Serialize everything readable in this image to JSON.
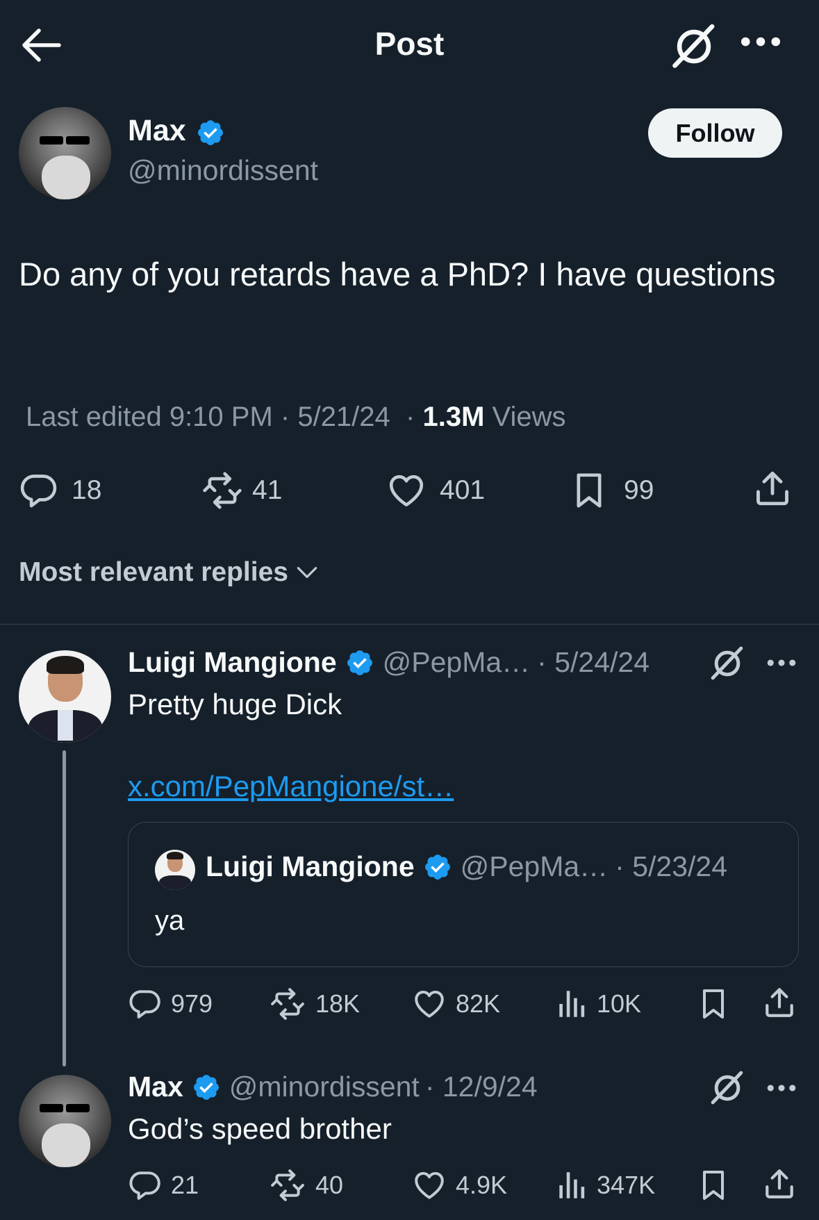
{
  "header": {
    "title": "Post"
  },
  "post": {
    "author_name": "Max",
    "author_handle": "@minordissent",
    "follow_label": "Follow",
    "text": "Do any of you retards have a PhD? I have questions",
    "edited_label": "Last edited 9:10 PM · 5/21/24",
    "views_separator": "·",
    "views_count": "1.3M",
    "views_label": "Views",
    "stats": {
      "replies": "18",
      "reposts": "41",
      "likes": "401",
      "bookmarks": "99"
    }
  },
  "replies_sort": {
    "label": "Most relevant replies"
  },
  "reply1": {
    "name": "Luigi Mangione",
    "handle": "@PepMa…",
    "date": "· 5/24/24",
    "text": "Pretty huge Dick",
    "link": "x.com/PepMangione/st…",
    "quote": {
      "name": "Luigi Mangione",
      "handle": "@PepMa…",
      "date": "· 5/23/24",
      "text": "ya"
    },
    "stats": {
      "replies": "979",
      "reposts": "18K",
      "likes": "82K",
      "views": "10K"
    }
  },
  "reply2": {
    "name": "Max",
    "handle": "@minordissent",
    "date": "· 12/9/24",
    "text": "God’s speed brother",
    "stats": {
      "replies": "21",
      "reposts": "40",
      "likes": "4.9K",
      "views": "347K"
    }
  },
  "colors": {
    "background": "#15202b",
    "text": "#f7f9f9",
    "muted": "#8b98a5",
    "verified": "#1d9bf0",
    "link": "#1d9bf0",
    "follow_bg": "#eff3f4"
  }
}
